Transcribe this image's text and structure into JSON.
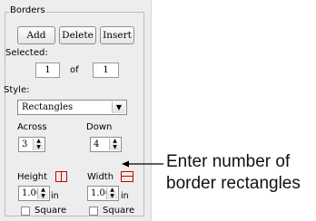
{
  "borders": {
    "group_label": "Borders",
    "add_label": "Add",
    "delete_label": "Delete",
    "insert_label": "Insert",
    "selected_label": "Selected:",
    "selected_value": "1",
    "of_label": "of",
    "total_value": "1",
    "style_label": "Style:",
    "style_value": "Rectangles",
    "across_label": "Across",
    "across_value": "3",
    "down_label": "Down",
    "down_value": "4",
    "height_label": "Height",
    "height_value": "1.00",
    "height_unit": "in",
    "width_label": "Width",
    "width_value": "1.00",
    "width_unit": "in",
    "square_label": "Square",
    "square2_label": "Square"
  },
  "callout": {
    "line1": "Enter number of",
    "line2": "border rectangles"
  }
}
